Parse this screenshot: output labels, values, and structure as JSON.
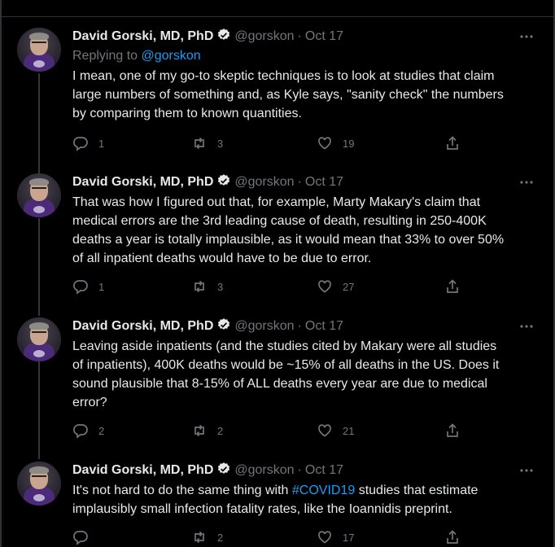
{
  "tweets": [
    {
      "author_name": "David Gorski, MD, PhD",
      "handle": "@gorskon",
      "separator": "·",
      "date": "Oct 17",
      "replying_prefix": "Replying to",
      "replying_to": "@gorskon",
      "text_lines": [
        "I mean, one of my go-to skeptic techniques is to look at studies that claim",
        "large numbers of something and, as Kyle says, \"sanity check\" the numbers",
        "by comparing them to known quantities."
      ],
      "replies": "1",
      "retweets": "3",
      "likes": "19"
    },
    {
      "author_name": "David Gorski, MD, PhD",
      "handle": "@gorskon",
      "separator": "·",
      "date": "Oct 17",
      "text_lines": [
        "That was how I figured out that, for example, Marty Makary's claim that",
        "medical errors are the 3rd leading cause of death, resulting in 250-400K",
        "deaths a year is totally implausible, as it would mean that 33% to over 50%",
        "of all inpatient deaths would have to be due to error."
      ],
      "replies": "1",
      "retweets": "3",
      "likes": "27"
    },
    {
      "author_name": "David Gorski, MD, PhD",
      "handle": "@gorskon",
      "separator": "·",
      "date": "Oct 17",
      "text_lines": [
        "Leaving aside inpatients (and the studies cited by Makary were all studies",
        "of inpatients), 400K deaths would be ~15% of all deaths in the US. Does it",
        "sound plausible that 8-15% of ALL deaths every year are due to medical",
        "error?"
      ],
      "replies": "2",
      "retweets": "2",
      "likes": "21"
    },
    {
      "author_name": "David Gorski, MD, PhD",
      "handle": "@gorskon",
      "separator": "·",
      "date": "Oct 17",
      "text_line1_before": "It's not hard to do the same thing with ",
      "hashtag": "#COVID19",
      "text_line1_after": " studies that estimate",
      "text_line2": "implausibly small infection fatality rates, like the Ioannidis preprint.",
      "replies": "",
      "retweets": "2",
      "likes": "17"
    }
  ],
  "icons": {
    "verified": "verified-badge-icon",
    "more": "more-dots-icon",
    "reply": "reply-bubble-icon",
    "retweet": "retweet-icon",
    "like": "heart-icon",
    "share": "share-icon"
  },
  "colors": {
    "background": "#000000",
    "text": "#e7e9ea",
    "muted": "#71767b",
    "link": "#1d9bf0",
    "thread_line": "#333639"
  }
}
